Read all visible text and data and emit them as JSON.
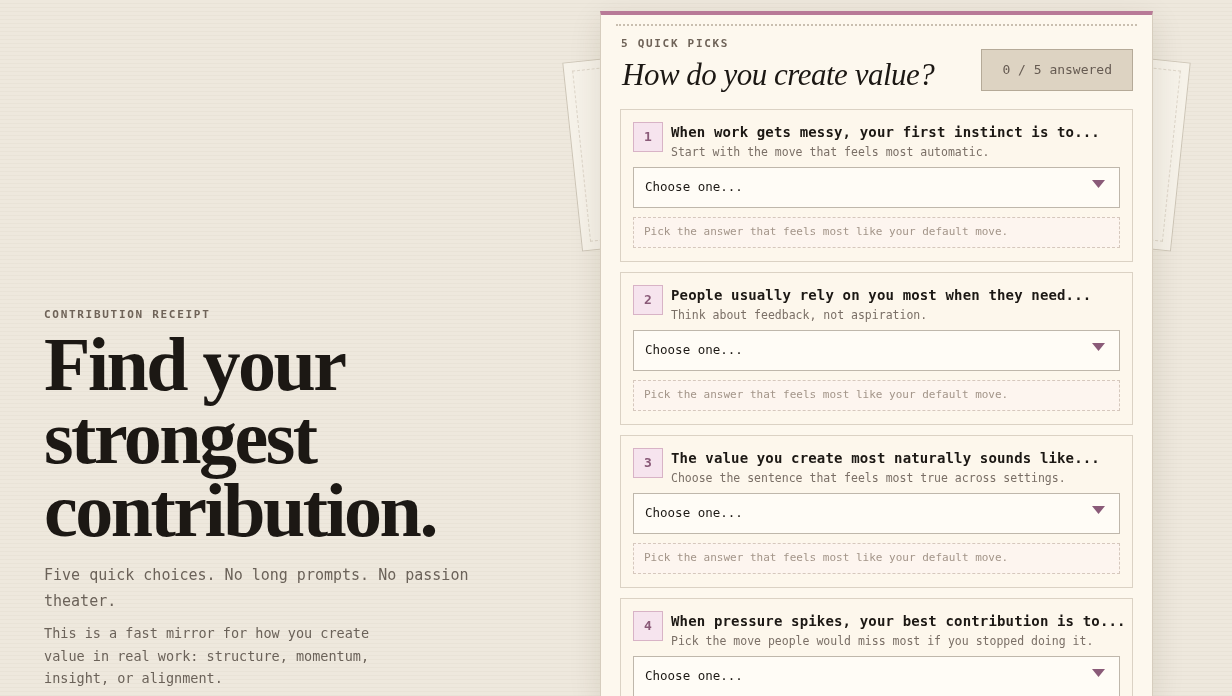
{
  "hero": {
    "eyebrow": "CONTRIBUTION RECEIPT",
    "title": "Find your strongest contribution.",
    "lead": "Five quick choices. No long prompts. No passion theater.",
    "body": "This is a fast mirror for how you create value in real work: structure, momentum, insight, or alignment."
  },
  "quiz": {
    "eyebrow": "5 QUICK PICKS",
    "title": "How do you create value?",
    "progress": "0 / 5 answered",
    "questions": [
      {
        "number": "1",
        "prompt": "When work gets messy, your first instinct is to...",
        "helper": "Start with the move that feels most automatic.",
        "dropdown": "Choose one...",
        "note": "Pick the answer that feels most like your default move."
      },
      {
        "number": "2",
        "prompt": "People usually rely on you most when they need...",
        "helper": "Think about feedback, not aspiration.",
        "dropdown": "Choose one...",
        "note": "Pick the answer that feels most like your default move."
      },
      {
        "number": "3",
        "prompt": "The value you create most naturally sounds like...",
        "helper": "Choose the sentence that feels most true across settings.",
        "dropdown": "Choose one...",
        "note": "Pick the answer that feels most like your default move."
      },
      {
        "number": "4",
        "prompt": "When pressure spikes, your best contribution is to...",
        "helper": "Pick the move people would miss most if you stopped doing it.",
        "dropdown": "Choose one..."
      }
    ]
  }
}
